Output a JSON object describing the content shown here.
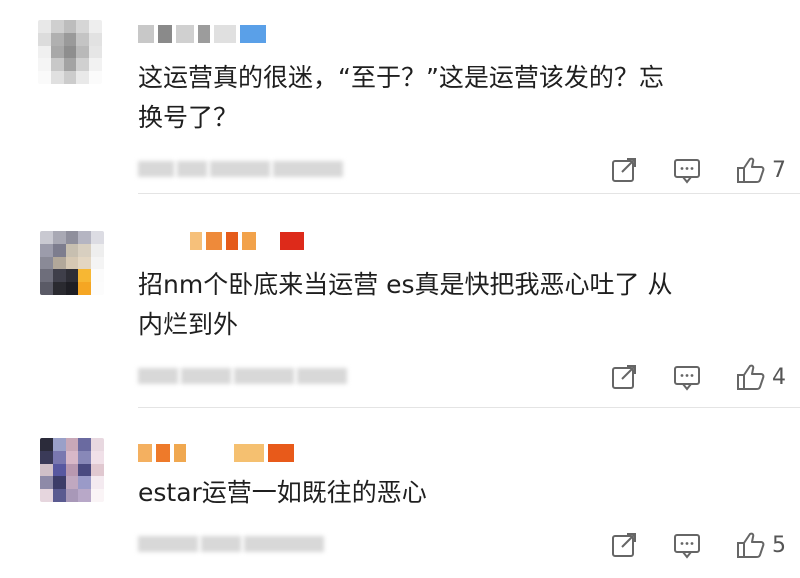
{
  "comments": [
    {
      "text": "这运营真的很迷，“至于？”这是运营该发的？忘\n换号了？",
      "like_count": "7",
      "avatar_colors": [
        "#e8e8e8",
        "#cfcfcf",
        "#bdbdbd",
        "#d6d6d6",
        "#eeeeee",
        "#dcdcdc",
        "#b0b0b0",
        "#9a9a9a",
        "#c4c4c4",
        "#e2e2e2",
        "#f0f0f0",
        "#a8a8a8",
        "#8e8e8e",
        "#b9b9b9",
        "#e6e6e6",
        "#f5f5f5",
        "#c8c8c8",
        "#a3a3a3",
        "#d0d0d0",
        "#f2f2f2",
        "#fafafa",
        "#e0e0e0",
        "#cccccc",
        "#e9e9e9",
        "#fbfbfb"
      ],
      "name_blocks": [
        "#c8c8c8",
        "#8a8a8a",
        "#d0d0d0",
        "#9c9c9c",
        "#e0e0e0",
        "#5aa0e8"
      ]
    },
    {
      "text": "招nm个卧底来当运营 es真是快把我恶心吐了 从\n内烂到外",
      "like_count": "4",
      "avatar_colors": [
        "#c9c9d1",
        "#a9a9b4",
        "#8f8f9c",
        "#b5b5c2",
        "#dcdce3",
        "#9c9cab",
        "#7d7d8e",
        "#c7bfb0",
        "#d8cfc0",
        "#eeeeee",
        "#8a8a97",
        "#b2a89a",
        "#d6c8b3",
        "#e3d6c2",
        "#f4f4f4",
        "#6e6e7b",
        "#3f3f4a",
        "#2e2e36",
        "#f7b733",
        "#fbfbfb",
        "#5a5a66",
        "#2a2a30",
        "#1e1e24",
        "#f5a623",
        "#fcfcfc"
      ],
      "name_blocks": [
        "#f6c07a",
        "#ee8a3a",
        "#e55b1a",
        "#f2a24a",
        "#dd2a1a",
        "#ffffff"
      ]
    },
    {
      "text": "estar运营一如既往的恶心",
      "like_count": "5",
      "avatar_colors": [
        "#2b2b3a",
        "#9aa0c8",
        "#c8a8b8",
        "#6a6aa0",
        "#e8d8e0",
        "#3a3a58",
        "#7a78b0",
        "#d8b8c8",
        "#8888b8",
        "#f0e0e8",
        "#d0c0c8",
        "#5858a0",
        "#b898b0",
        "#4a4a80",
        "#e0c8d0",
        "#8e8aa8",
        "#3c3c68",
        "#c0a8c0",
        "#9a9ac8",
        "#f4eaf0",
        "#e6d6de",
        "#5a5a90",
        "#a898b8",
        "#b8a8c8",
        "#faf4f6"
      ],
      "name_blocks": [
        "#f4b060",
        "#ee7a2a",
        "#f0a850",
        "#f5c070",
        "#e85a1a",
        "#f6c23a"
      ]
    }
  ]
}
